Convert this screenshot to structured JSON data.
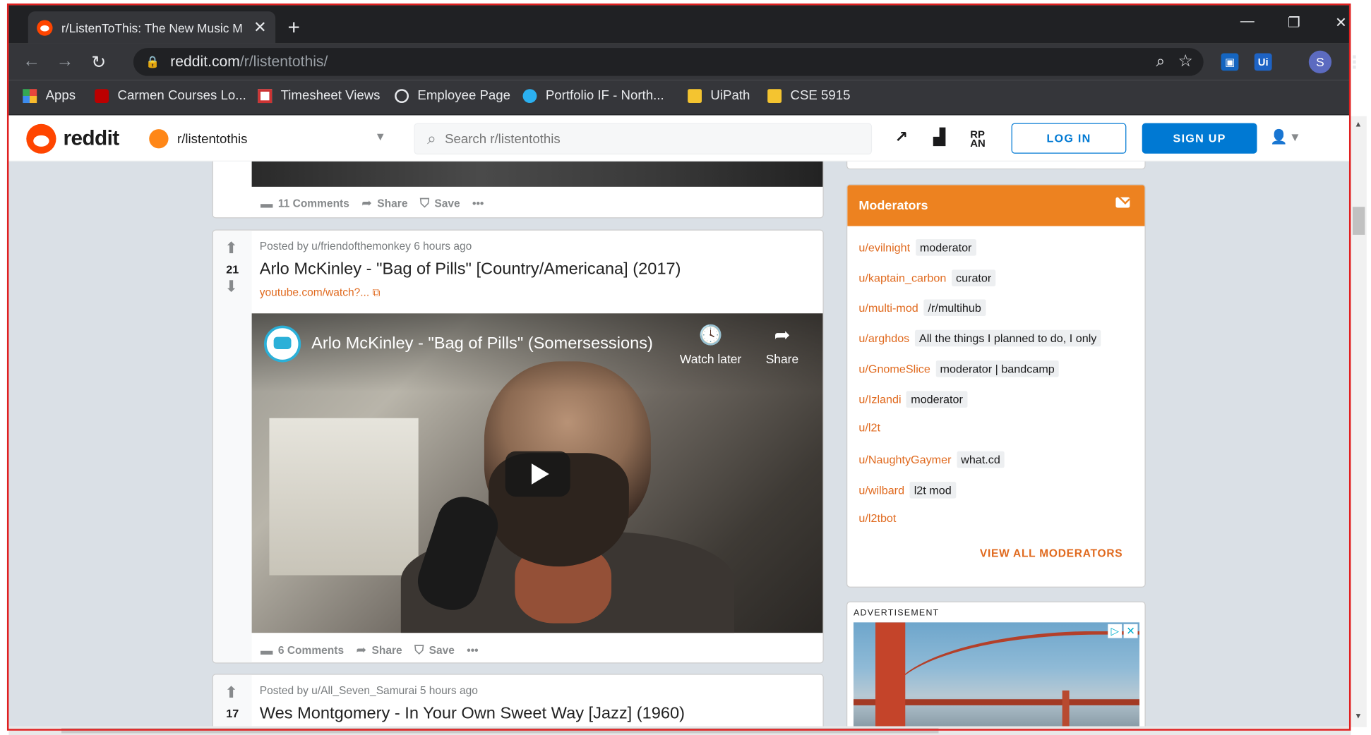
{
  "browser": {
    "tab_title": "r/ListenToThis: The New Music M",
    "url_host": "reddit.com",
    "url_path": "/r/listentothis/",
    "profile_initial": "S",
    "bookmarks": [
      {
        "label": "Apps",
        "icon": "apps-grid-icon",
        "color": "#e8453c"
      },
      {
        "label": "Carmen Courses Lo...",
        "icon": "carmen-icon",
        "color": "#bb0000"
      },
      {
        "label": "Timesheet Views",
        "icon": "timesheet-icon",
        "color": "#cc3333"
      },
      {
        "label": "Employee Page",
        "icon": "globe-icon",
        "color": "#e8eaed"
      },
      {
        "label": "Portfolio IF - North...",
        "icon": "edge-icon",
        "color": "#2bb0f0"
      },
      {
        "label": "UiPath",
        "icon": "folder-icon",
        "color": "#f4c430"
      },
      {
        "label": "CSE 5915",
        "icon": "folder-icon",
        "color": "#f4c430"
      }
    ]
  },
  "reddit": {
    "logo_text": "reddit",
    "community": "r/listentothis",
    "search_placeholder": "Search r/listentothis",
    "login_label": "LOG IN",
    "signup_label": "SIGN UP",
    "accent": "#0079d3",
    "brand": "#ff4500"
  },
  "posts": [
    {
      "actions": {
        "comments": "11 Comments",
        "share": "Share",
        "save": "Save",
        "more": "•••"
      }
    },
    {
      "score": "21",
      "meta": "Posted by u/friendofthemonkey 6 hours ago",
      "title": "Arlo McKinley - \"Bag of Pills\" [Country/Americana] (2017)",
      "link": "youtube.com/watch?...",
      "video_title": "Arlo McKinley - \"Bag of Pills\" (Somersessions)",
      "watch_later": "Watch later",
      "video_share": "Share",
      "actions": {
        "comments": "6 Comments",
        "share": "Share",
        "save": "Save",
        "more": "•••"
      }
    },
    {
      "score": "17",
      "meta": "Posted by u/All_Seven_Samurai 5 hours ago",
      "title": "Wes Montgomery - In Your Own Sweet Way [Jazz] (1960)"
    }
  ],
  "moderators": {
    "title": "Moderators",
    "accent": "#ed8220",
    "list": [
      {
        "user": "u/evilnight",
        "flair": "moderator"
      },
      {
        "user": "u/kaptain_carbon",
        "flair": "curator"
      },
      {
        "user": "u/multi-mod",
        "flair": "/r/multihub"
      },
      {
        "user": "u/arghdos",
        "flair": "All the things I planned to do, I only"
      },
      {
        "user": "u/GnomeSlice",
        "flair": "moderator | bandcamp"
      },
      {
        "user": "u/Izlandi",
        "flair": "moderator"
      },
      {
        "user": "u/l2t",
        "flair": ""
      },
      {
        "user": "u/NaughtyGaymer",
        "flair": "what.cd"
      },
      {
        "user": "u/wilbard",
        "flair": "l2t mod"
      },
      {
        "user": "u/l2tbot",
        "flair": ""
      }
    ],
    "view_all": "VIEW ALL MODERATORS"
  },
  "ad": {
    "label": "ADVERTISEMENT"
  }
}
